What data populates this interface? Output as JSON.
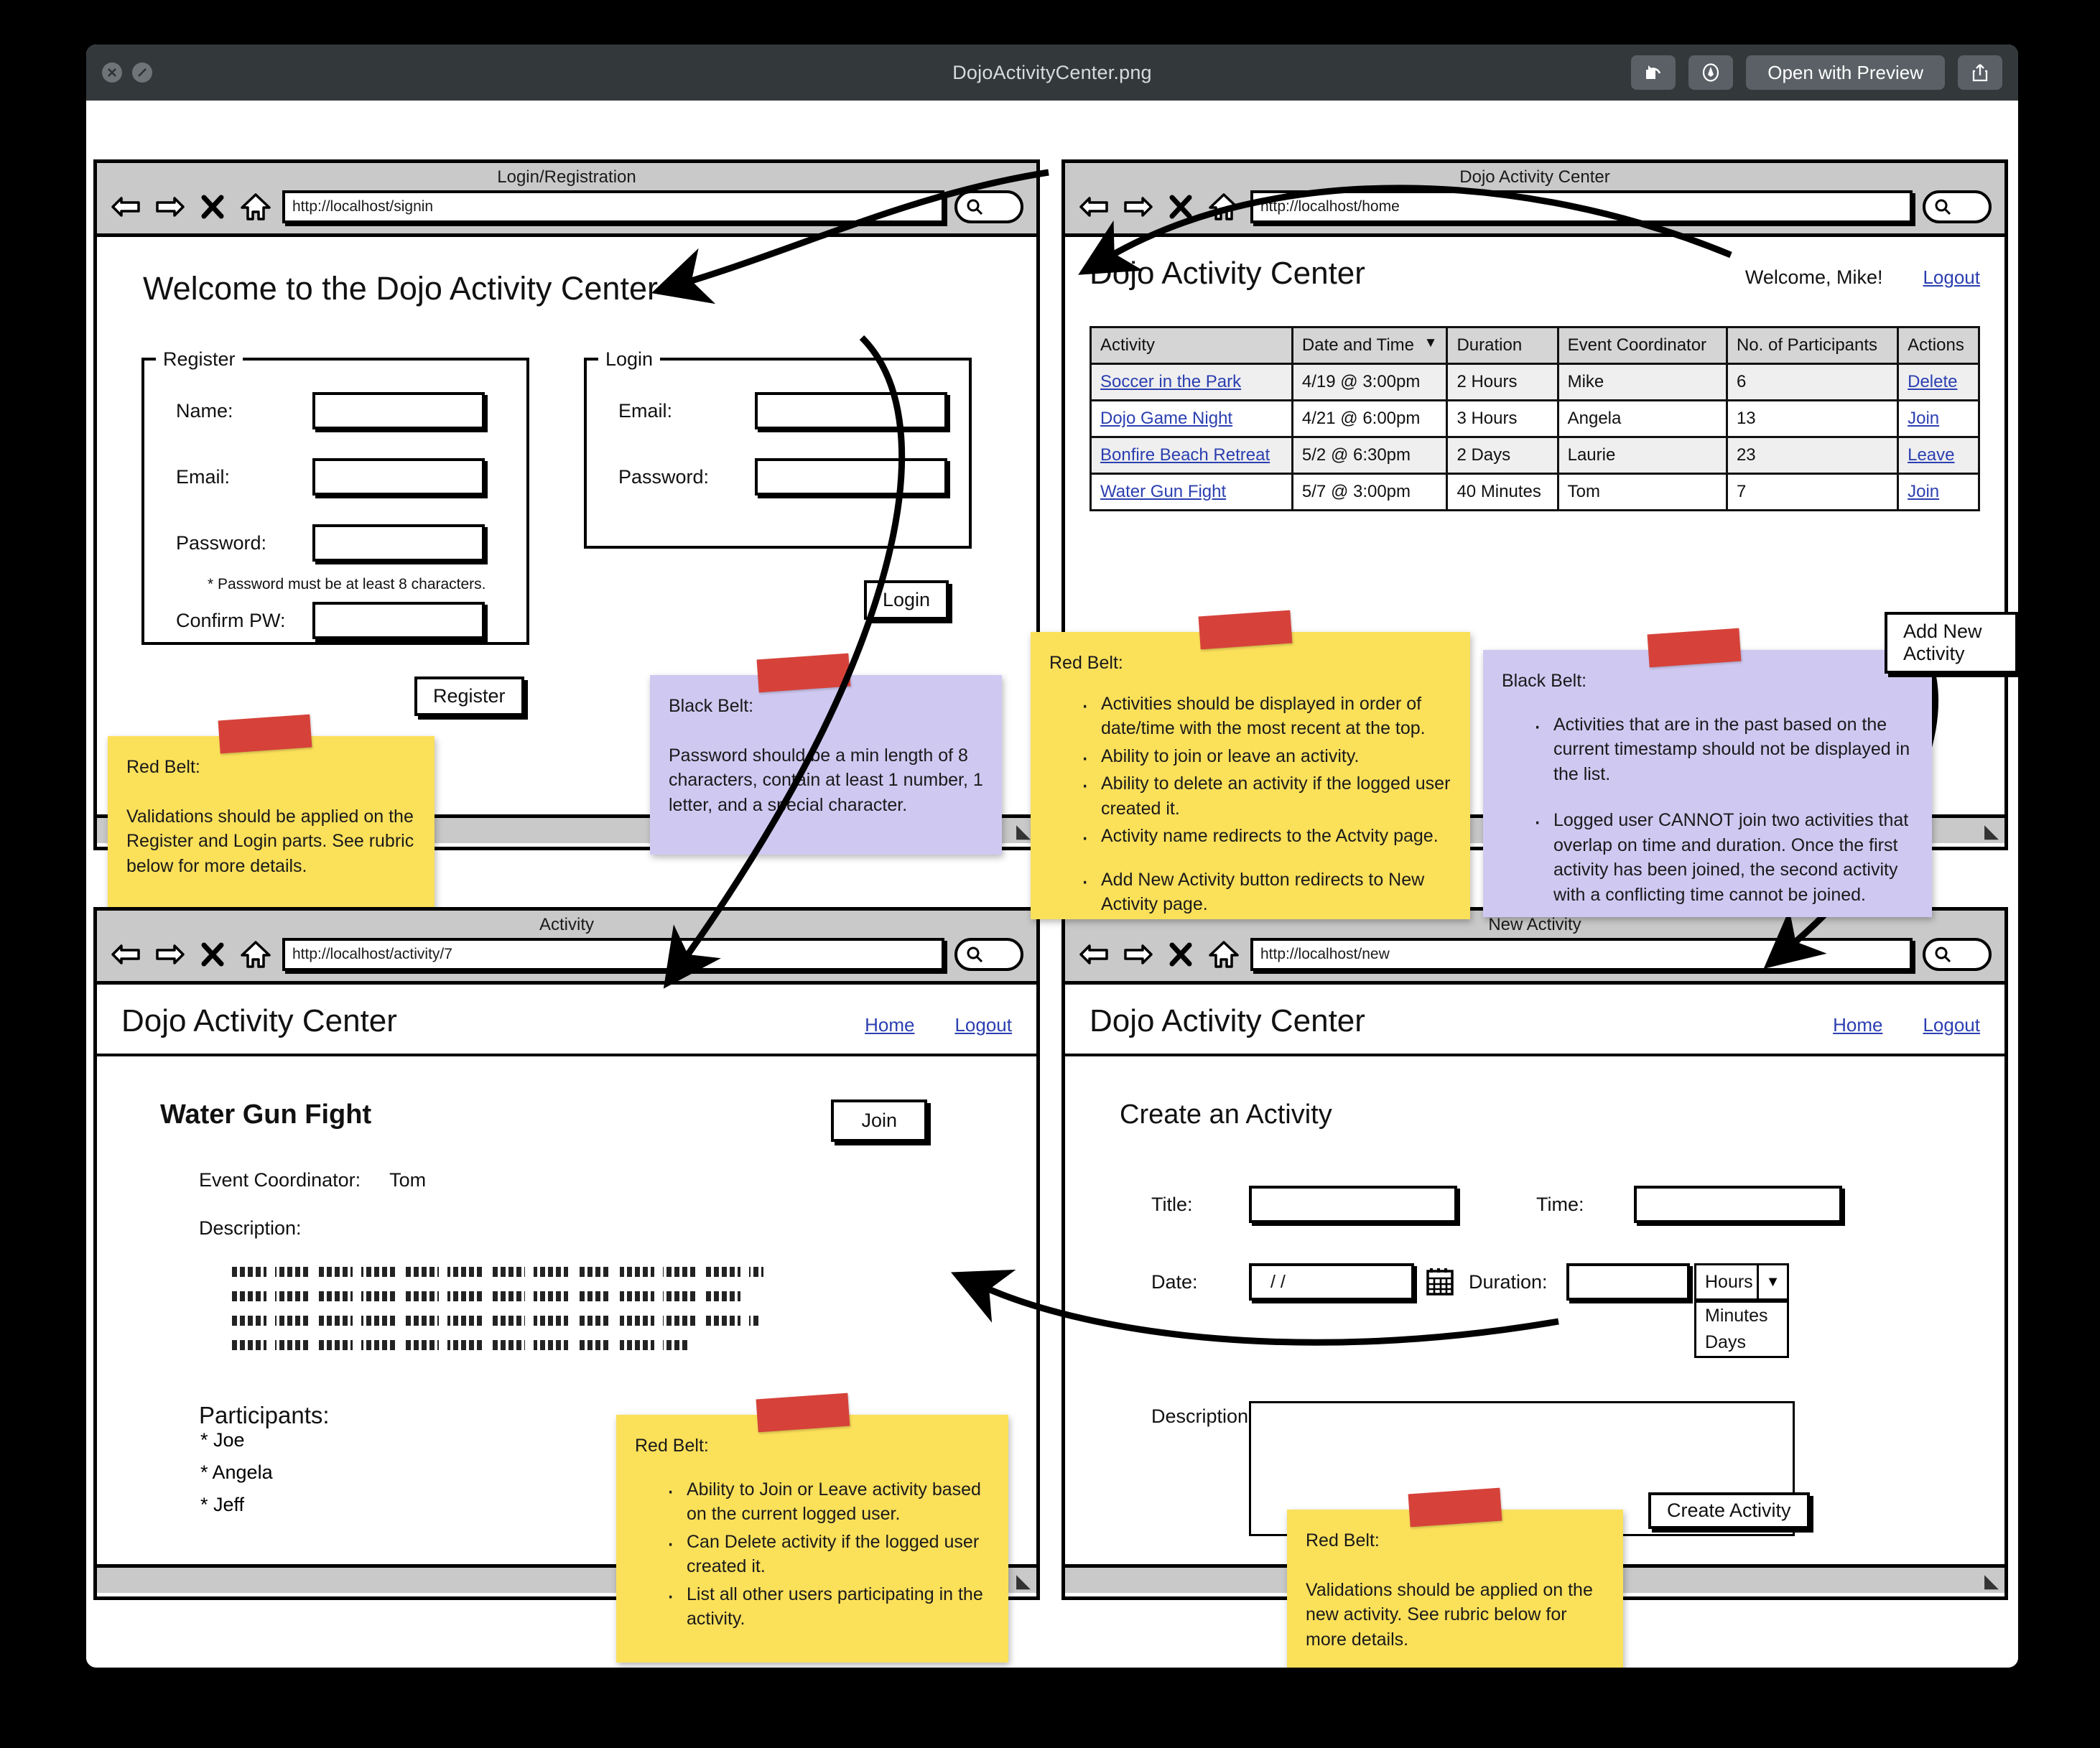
{
  "window": {
    "title": "DojoActivityCenter.png",
    "close_icon": "close-icon",
    "minimize_icon": "minimize-icon",
    "rotate_label": "rotate-icon",
    "markup_label": "markup-icon",
    "open_with_preview": "Open with Preview",
    "share_label": "share-icon"
  },
  "panels": {
    "signin": {
      "chrome_title": "Login/Registration",
      "url": "http://localhost/signin",
      "page_title": "Welcome to the Dojo Activity Center",
      "register": {
        "legend": "Register",
        "name_label": "Name:",
        "email_label": "Email:",
        "password_label": "Password:",
        "password_hint": "* Password must be at least 8 characters.",
        "confirm_label": "Confirm PW:",
        "submit_label": "Register",
        "name_value": "",
        "email_value": "",
        "password_value": "",
        "confirm_value": ""
      },
      "login": {
        "legend": "Login",
        "email_label": "Email:",
        "password_label": "Password:",
        "submit_label": "Login",
        "email_value": "",
        "password_value": ""
      },
      "note_red": {
        "title": "Red Belt:",
        "body": "Validations should be applied on the Register and Login parts. See rubric below for more details."
      },
      "note_black": {
        "title": "Black Belt:",
        "body": "Password should be a min length of 8 characters, contain at least 1 number, 1 letter, and a special character."
      }
    },
    "home": {
      "chrome_title": "Dojo Activity Center",
      "url": "http://localhost/home",
      "brand": "Dojo Activity Center",
      "welcome": "Welcome, Mike!",
      "logout": "Logout",
      "add_button": "Add New Activity",
      "table": {
        "columns": [
          "Activity",
          "Date and Time",
          "Duration",
          "Event Coordinator",
          "No. of Participants",
          "Actions"
        ],
        "sorted_column": "Date and Time",
        "sort_caret": "▼",
        "rows": [
          {
            "activity": "Soccer in the Park",
            "datetime": "4/19 @ 3:00pm",
            "duration": "2 Hours",
            "coordinator": "Mike",
            "participants": "6",
            "action": "Delete"
          },
          {
            "activity": "Dojo Game Night",
            "datetime": "4/21 @ 6:00pm",
            "duration": "3 Hours",
            "coordinator": "Angela",
            "participants": "13",
            "action": "Join"
          },
          {
            "activity": "Bonfire Beach Retreat",
            "datetime": "5/2 @ 6:30pm",
            "duration": "2 Days",
            "coordinator": "Laurie",
            "participants": "23",
            "action": "Leave"
          },
          {
            "activity": "Water Gun Fight",
            "datetime": "5/7 @ 3:00pm",
            "duration": "40 Minutes",
            "coordinator": "Tom",
            "participants": "7",
            "action": "Join"
          }
        ]
      },
      "note_red": {
        "title": "Red Belt:",
        "bullets": [
          "Activities should be displayed in order of date/time with the most recent at the top.",
          "Ability to join or leave an activity.",
          "Ability to delete an activity if the logged user created it.",
          "Activity name redirects to the Actvity page."
        ],
        "bullets_extra": [
          "Add New Activity button redirects to New Activity page."
        ]
      },
      "note_black": {
        "title": "Black Belt:",
        "bullets": [
          "Activities that are in the past based on the current timestamp should not be displayed in the list.",
          "Logged user CANNOT join two activities that overlap on time and duration. Once the first activity has been joined, the second activity with a conflicting time cannot be joined."
        ]
      }
    },
    "activity": {
      "chrome_title": "Activity",
      "url": "http://localhost/activity/7",
      "brand": "Dojo Activity Center",
      "home_link": "Home",
      "logout_link": "Logout",
      "activity_title": "Water Gun Fight",
      "join_button": "Join",
      "coordinator_label": "Event Coordinator:",
      "coordinator_name": "Tom",
      "description_label": "Description:",
      "participants_label": "Participants:",
      "participants": [
        "* Joe",
        "* Angela",
        "* Jeff"
      ],
      "note_red": {
        "title": "Red Belt:",
        "bullets": [
          "Ability to Join or Leave activity based on the current logged user.",
          "Can Delete activity if the logged user created it.",
          "List all other users participating in the activity."
        ]
      }
    },
    "new": {
      "chrome_title": "New Activity",
      "url": "http://localhost/new",
      "brand": "Dojo Activity Center",
      "home_link": "Home",
      "logout_link": "Logout",
      "page_title": "Create an Activity",
      "title_label": "Title:",
      "title_value": "",
      "time_label": "Time:",
      "time_value": "",
      "date_label": "Date:",
      "date_value": "/ /",
      "calendar_icon": "calendar-icon",
      "duration_label": "Duration:",
      "duration_value": "",
      "duration_unit_selected": "Hours",
      "duration_unit_options": [
        "Minutes",
        "Days"
      ],
      "description_label": "Description:",
      "description_value": "",
      "create_button": "Create Activity",
      "note_red": {
        "title": "Red Belt:",
        "body": "Validations should be applied on the new activity. See rubric below for more details."
      }
    }
  }
}
